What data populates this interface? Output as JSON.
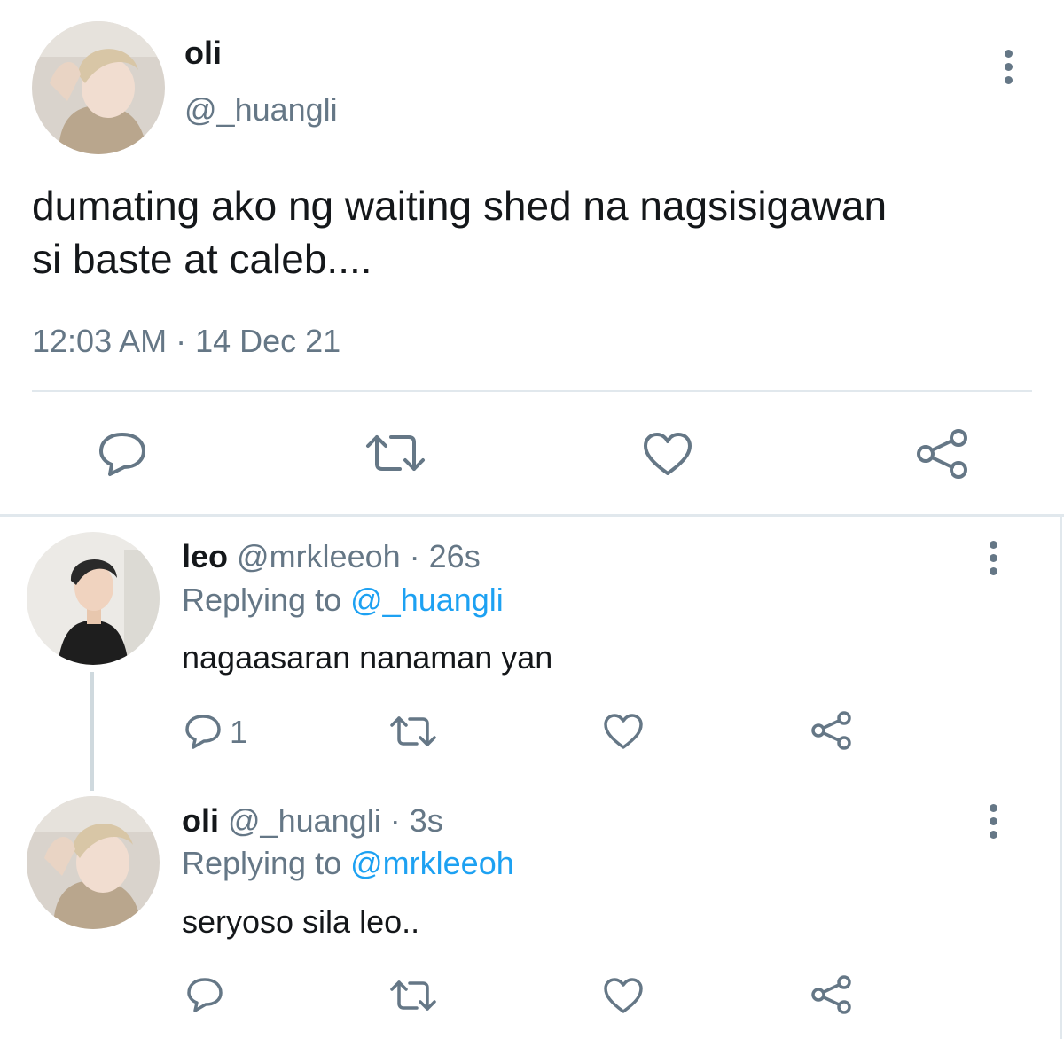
{
  "main_tweet": {
    "author_name": "oli",
    "author_handle": "@_huangli",
    "text_line1": "dumating ako ng waiting shed na nagsisigawan",
    "text_line2": "si baste at caleb....",
    "timestamp": "12:03 AM · 14 Dec 21",
    "actions": [
      "reply-icon",
      "retweet-icon",
      "like-icon",
      "share-icon"
    ]
  },
  "replies": [
    {
      "author_name": "leo",
      "author_handle": "@mrkleeoh",
      "age": "· 26s",
      "replying_label": "Replying to",
      "replying_to": "@_huangli",
      "text": "nagaasaran nanaman yan",
      "reply_count": "1"
    },
    {
      "author_name": "oli",
      "author_handle": "@_huangli",
      "age": "· 3s",
      "replying_label": "Replying to",
      "replying_to": "@mrkleeoh",
      "text": "seryoso sila leo..",
      "reply_count": ""
    }
  ],
  "colors": {
    "text": "#14171a",
    "muted": "#657786",
    "link": "#1da1f2",
    "divider": "#e1e8ed"
  }
}
